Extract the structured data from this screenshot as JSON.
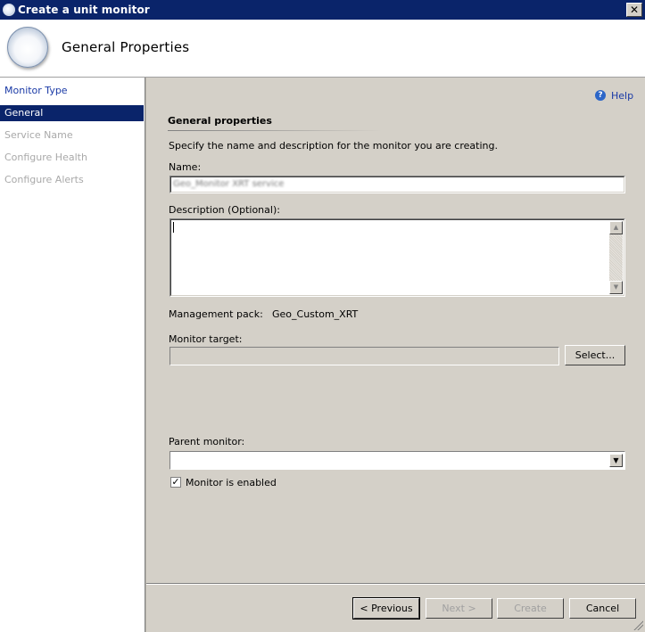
{
  "window": {
    "title": "Create a unit monitor"
  },
  "header": {
    "title": "General Properties",
    "icon": "monitor-wizard-icon"
  },
  "nav": {
    "items": [
      {
        "label": "Monitor Type",
        "state": "link"
      },
      {
        "label": "General",
        "state": "active"
      },
      {
        "label": "Service Name",
        "state": "disabled"
      },
      {
        "label": "Configure Health",
        "state": "disabled"
      },
      {
        "label": "Configure Alerts",
        "state": "disabled"
      }
    ]
  },
  "help": {
    "label": "Help",
    "icon": "help-icon"
  },
  "form": {
    "section_title": "General properties",
    "intro": "Specify the name and description for the monitor you are creating.",
    "name_label": "Name:",
    "name_value": "Geo_Monitor XRT service",
    "description_label": "Description (Optional):",
    "description_value": "",
    "management_pack_label": "Management pack:",
    "management_pack_value": "Geo_Custom_XRT",
    "monitor_target_label": "Monitor target:",
    "monitor_target_value": "",
    "select_button": "Select...",
    "parent_monitor_label": "Parent monitor:",
    "parent_monitor_value": "",
    "monitor_enabled_label": "Monitor is enabled",
    "monitor_enabled_checked": true
  },
  "footer": {
    "previous": "< Previous",
    "next": "Next >",
    "create": "Create",
    "cancel": "Cancel"
  },
  "colors": {
    "titlebar": "#0a246a",
    "nav_active": "#0a246a",
    "link": "#1a3aa6",
    "panel": "#d4d0c8"
  }
}
